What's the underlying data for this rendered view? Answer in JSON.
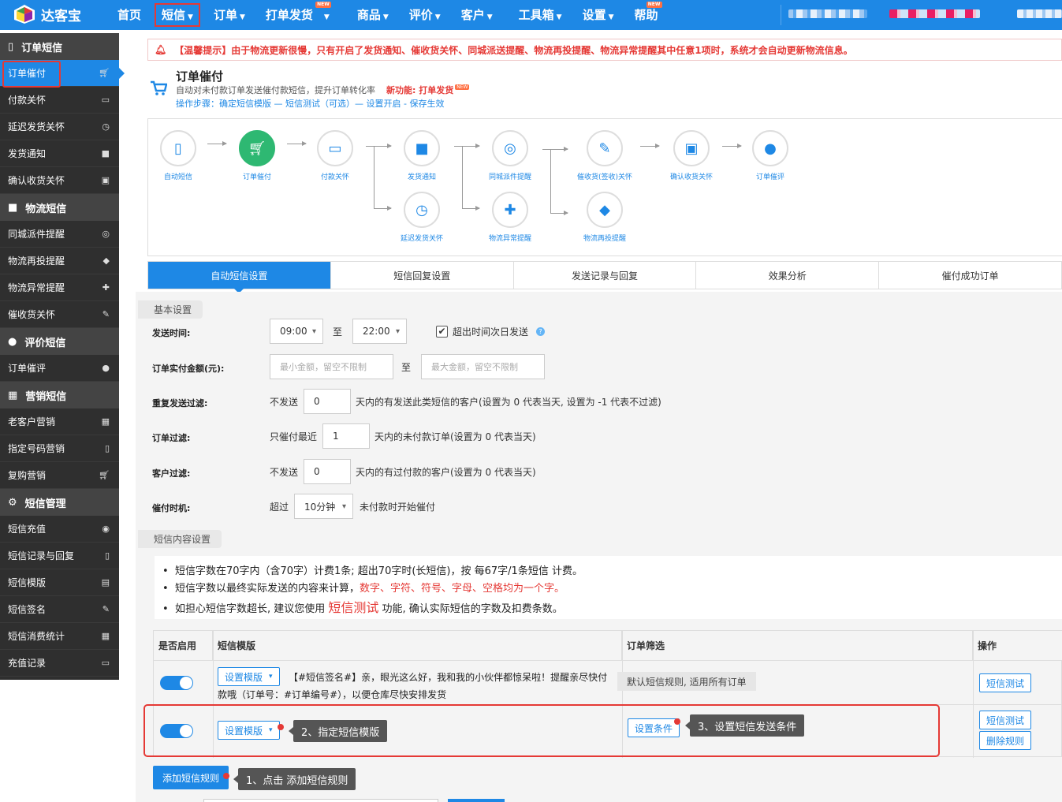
{
  "app": {
    "logo_text": "达客宝"
  },
  "nav": {
    "items": [
      {
        "label": "首页",
        "caret": false
      },
      {
        "label": "短信",
        "caret": true,
        "active": true
      },
      {
        "label": "订单",
        "caret": true
      },
      {
        "label": "打单发货",
        "caret": true,
        "new": "NEW"
      },
      {
        "label": "商品",
        "caret": true
      },
      {
        "label": "评价",
        "caret": true
      },
      {
        "label": "客户",
        "caret": true
      },
      {
        "label": "工具箱",
        "caret": true
      },
      {
        "label": "设置",
        "caret": true
      },
      {
        "label": "帮助",
        "caret": false,
        "new": "NEW"
      }
    ]
  },
  "sidebar": {
    "groups": [
      {
        "title": "订单短信",
        "icon": "mobile-icon",
        "items": [
          {
            "label": "订单催付",
            "icon": "cart-icon",
            "active": true
          },
          {
            "label": "付款关怀",
            "icon": "card-icon"
          },
          {
            "label": "延迟发货关怀",
            "icon": "clock-icon"
          },
          {
            "label": "发货通知",
            "icon": "truck-icon"
          },
          {
            "label": "确认收货关怀",
            "icon": "box-icon"
          }
        ]
      },
      {
        "title": "物流短信",
        "icon": "truck-icon",
        "items": [
          {
            "label": "同城派件提醒",
            "icon": "motorcycle-icon"
          },
          {
            "label": "物流再投提醒",
            "icon": "cube-icon"
          },
          {
            "label": "物流异常提醒",
            "icon": "ambulance-icon"
          },
          {
            "label": "催收货关怀",
            "icon": "pencil-icon"
          }
        ]
      },
      {
        "title": "评价短信",
        "icon": "comments-icon",
        "items": [
          {
            "label": "订单催评",
            "icon": "comment-icon"
          }
        ]
      },
      {
        "title": "营销短信",
        "icon": "gift-icon",
        "items": [
          {
            "label": "老客户营销",
            "icon": "gift-icon"
          },
          {
            "label": "指定号码营销",
            "icon": "mobile-icon"
          },
          {
            "label": "复购营销",
            "icon": "cart-icon"
          }
        ]
      },
      {
        "title": "短信管理",
        "icon": "gear-icon",
        "items": [
          {
            "label": "短信充值",
            "icon": "coins-icon"
          },
          {
            "label": "短信记录与回复",
            "icon": "mobile-icon"
          },
          {
            "label": "短信模版",
            "icon": "file-icon"
          },
          {
            "label": "短信签名",
            "icon": "edit-icon"
          },
          {
            "label": "短信消费统计",
            "icon": "calculator-icon"
          },
          {
            "label": "充值记录",
            "icon": "card-icon"
          }
        ]
      }
    ]
  },
  "notice": "【温馨提示】由于物流更新很慢，只有开启了发货通知、催收货关怀、同城派送提醒、物流再投提醒、物流异常提醒其中任意1项时，系统才会自动更新物流信息。",
  "header": {
    "title": "订单催付",
    "subtitle": "自动对未付款订单发送催付款短信，提升订单转化率",
    "new_feature": "新功能: 打单发货",
    "steps": "操作步骤：确定短信模版 — 短信测试（可选）— 设置开启 - 保存生效"
  },
  "flow": {
    "nodes": {
      "auto_sms": "自动短信",
      "order_urge": "订单催付",
      "pay_care": "付款关怀",
      "ship_notice": "发货通知",
      "delay_care": "延迟发货关怀",
      "city_delivery": "同城派件提醒",
      "logistics_error": "物流异常提醒",
      "receive_urge": "催收货(签收)关怀",
      "logistics_redeliver": "物流再投提醒",
      "confirm_care": "确认收货关怀",
      "review_urge": "订单催评"
    }
  },
  "tabs": [
    "自动短信设置",
    "短信回复设置",
    "发送记录与回复",
    "效果分析",
    "催付成功订单"
  ],
  "basic": {
    "section_title": "基本设置",
    "send_time_label": "发送时间:",
    "start_time": "09:00",
    "to": "至",
    "end_time": "22:00",
    "next_day_label": "超出时间次日发送",
    "next_day_checked": true,
    "amount_label": "订单实付金额(元):",
    "min_placeholder": "最小金额，留空不限制",
    "max_placeholder": "最大金额，留空不限制",
    "repeat_label": "重复发送过滤:",
    "repeat_prefix": "不发送",
    "repeat_value": "0",
    "repeat_suffix": "天内的有发送此类短信的客户(设置为 0 代表当天, 设置为 -1 代表不过滤)",
    "order_filter_label": "订单过滤:",
    "order_prefix": "只催付最近",
    "order_value": "1",
    "order_suffix": "天内的未付款订单(设置为 0 代表当天)",
    "customer_filter_label": "客户过滤:",
    "customer_prefix": "不发送",
    "customer_value": "0",
    "customer_suffix": "天内的有过付款的客户(设置为 0 代表当天)",
    "timing_label": "催付时机:",
    "timing_prefix": "超过",
    "timing_value": "10分钟",
    "timing_suffix": "未付款时开始催付"
  },
  "content": {
    "section_title": "短信内容设置",
    "line1": "短信字数在70字内（含70字）计费1条; 超出70字时(长短信)，按 每67字/1条短信 计费。",
    "line2_a": "短信字数以最终实际发送的内容来计算，",
    "line2_b": "数字、字符、符号、字母、空格均为一个字。",
    "line3_a": "如担心短信字数超长, 建议您使用",
    "line3_b": "短信测试",
    "line3_c": "功能, 确认实际短信的字数及扣费条数。"
  },
  "table": {
    "headers": [
      "是否启用",
      "短信模版",
      "订单筛选",
      "操作"
    ],
    "rows": [
      {
        "enabled": true,
        "template_btn": "设置模版",
        "template_text": "【#短信签名#】亲，眼光这么好，我和我的小伙伴都惊呆啦！提醒亲尽快付款哦（订单号：#订单编号#），以便仓库尽快安排发货",
        "filter_tip": "默认短信规则, 适用所有订单",
        "actions": [
          "短信测试"
        ]
      },
      {
        "enabled": true,
        "template_btn": "设置模版",
        "filter_btn": "设置条件",
        "actions": [
          "短信测试",
          "删除规则"
        ]
      }
    ]
  },
  "add_rule": "添加短信规则",
  "tips": {
    "tip1": "1、点击 添加短信规则",
    "tip2": "2、指定短信模版",
    "tip3": "3、设置短信发送条件"
  },
  "colors": {
    "primary": "#1e88e5",
    "accent_red": "#e53935",
    "active_green": "#2eb872",
    "sidebar": "#2f2f2f"
  }
}
